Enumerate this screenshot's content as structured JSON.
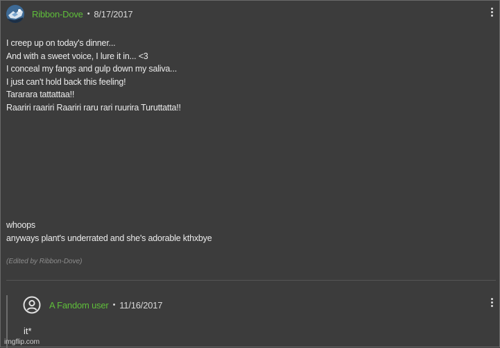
{
  "comment": {
    "author": "Ribbon-Dove",
    "separator": "•",
    "date": "8/17/2017",
    "lines": [
      "I creep up on today's dinner...",
      "And with a sweet voice, I lure it in... <3",
      "I conceal my fangs and gulp down my saliva...",
      "I just can't hold back this feeling!",
      "Tararara tattattaa!!",
      "Raariri raariri Raariri raru rari ruurira Turuttatta!!"
    ],
    "after_lines": [
      "whoops",
      "anyways plant's underrated and she's adorable kthxbye"
    ],
    "edited_note": "(Edited by Ribbon-Dove)",
    "avatar_icon": "avatar-image",
    "menu_icon": "kebab-menu-icon"
  },
  "reply": {
    "author": "A Fandom user",
    "separator": "•",
    "date": "11/16/2017",
    "text": "it*",
    "avatar_icon": "user-circle-icon",
    "menu_icon": "kebab-menu-icon"
  },
  "watermark": "imgflip.com",
  "colors": {
    "background": "#3c3c3c",
    "author": "#5fbf3a",
    "text": "#ececec",
    "muted": "#8e8e8e"
  }
}
